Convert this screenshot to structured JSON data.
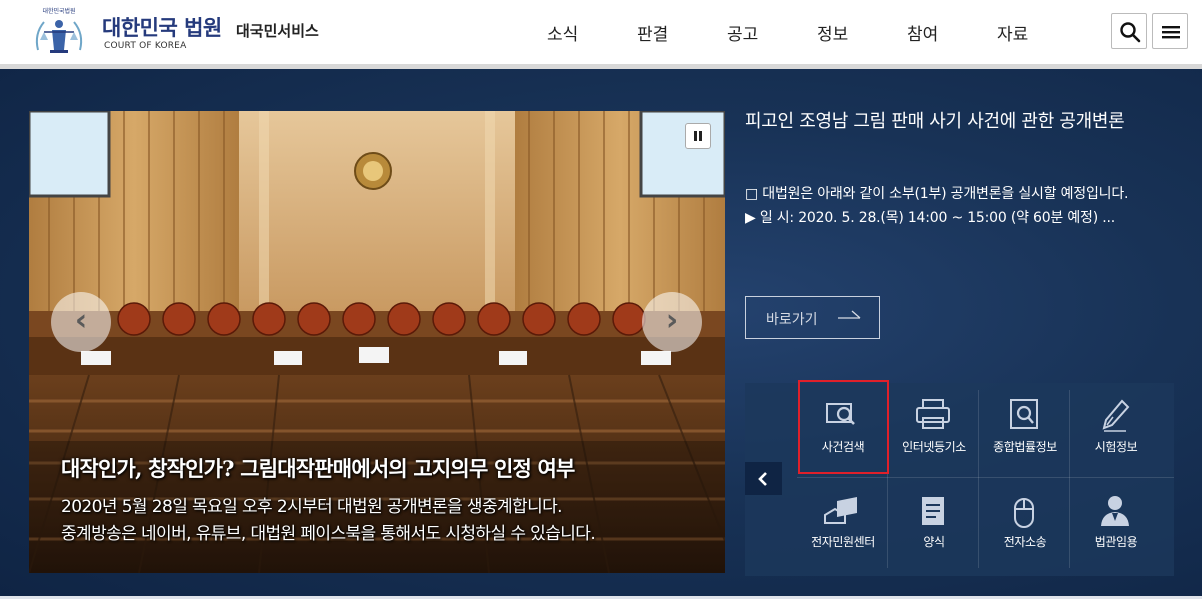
{
  "header": {
    "emblem_text": "대한민국법원",
    "logo_title": "대한민국 법원",
    "logo_subtitle": "COURT OF KOREA",
    "service_name": "대국민서비스",
    "nav": [
      "소식",
      "판결",
      "공고",
      "정보",
      "참여",
      "자료"
    ],
    "search_icon": "search-icon",
    "menu_icon": "hamburger-menu-icon"
  },
  "slide": {
    "caption_title": "대작인가, 창작인가? 그림대작판매에서의 고지의무 인정 여부",
    "caption_line1": "2020년 5월 28일 목요일 오후 2시부터 대법원 공개변론을 생중계합니다.",
    "caption_line2": "중계방송은 네이버, 유튜브, 대법원 페이스북을 통해서도 시청하실 수 있습니다.",
    "prev_arrow": "‹",
    "next_arrow": "›"
  },
  "news": {
    "title": "피고인 조영남 그림 판매 사기 사건에 관한 공개변론",
    "line1": "□ 대법원은 아래와 같이 소부(1부) 공개변론을 실시할 예정입니다.",
    "line2": "▶ 일 시: 2020. 5. 28.(목) 14:00 ~ 15:00 (약 60분 예정) ...",
    "goto_label": "바로가기"
  },
  "services": [
    {
      "label": "사건검색",
      "icon": "case-search-icon"
    },
    {
      "label": "인터넷등기소",
      "icon": "printer-icon"
    },
    {
      "label": "종합법률정보",
      "icon": "legal-info-icon"
    },
    {
      "label": "시험정보",
      "icon": "pen-nib-icon"
    },
    {
      "label": "전자민원센터",
      "icon": "electronic-petition-icon"
    },
    {
      "label": "양식",
      "icon": "form-document-icon"
    },
    {
      "label": "전자소송",
      "icon": "mouse-icon"
    },
    {
      "label": "법관임용",
      "icon": "judge-person-icon"
    }
  ],
  "colors": {
    "brand_navy": "#253a7c",
    "band_bg": "#183256",
    "highlight": "#e0202a"
  }
}
